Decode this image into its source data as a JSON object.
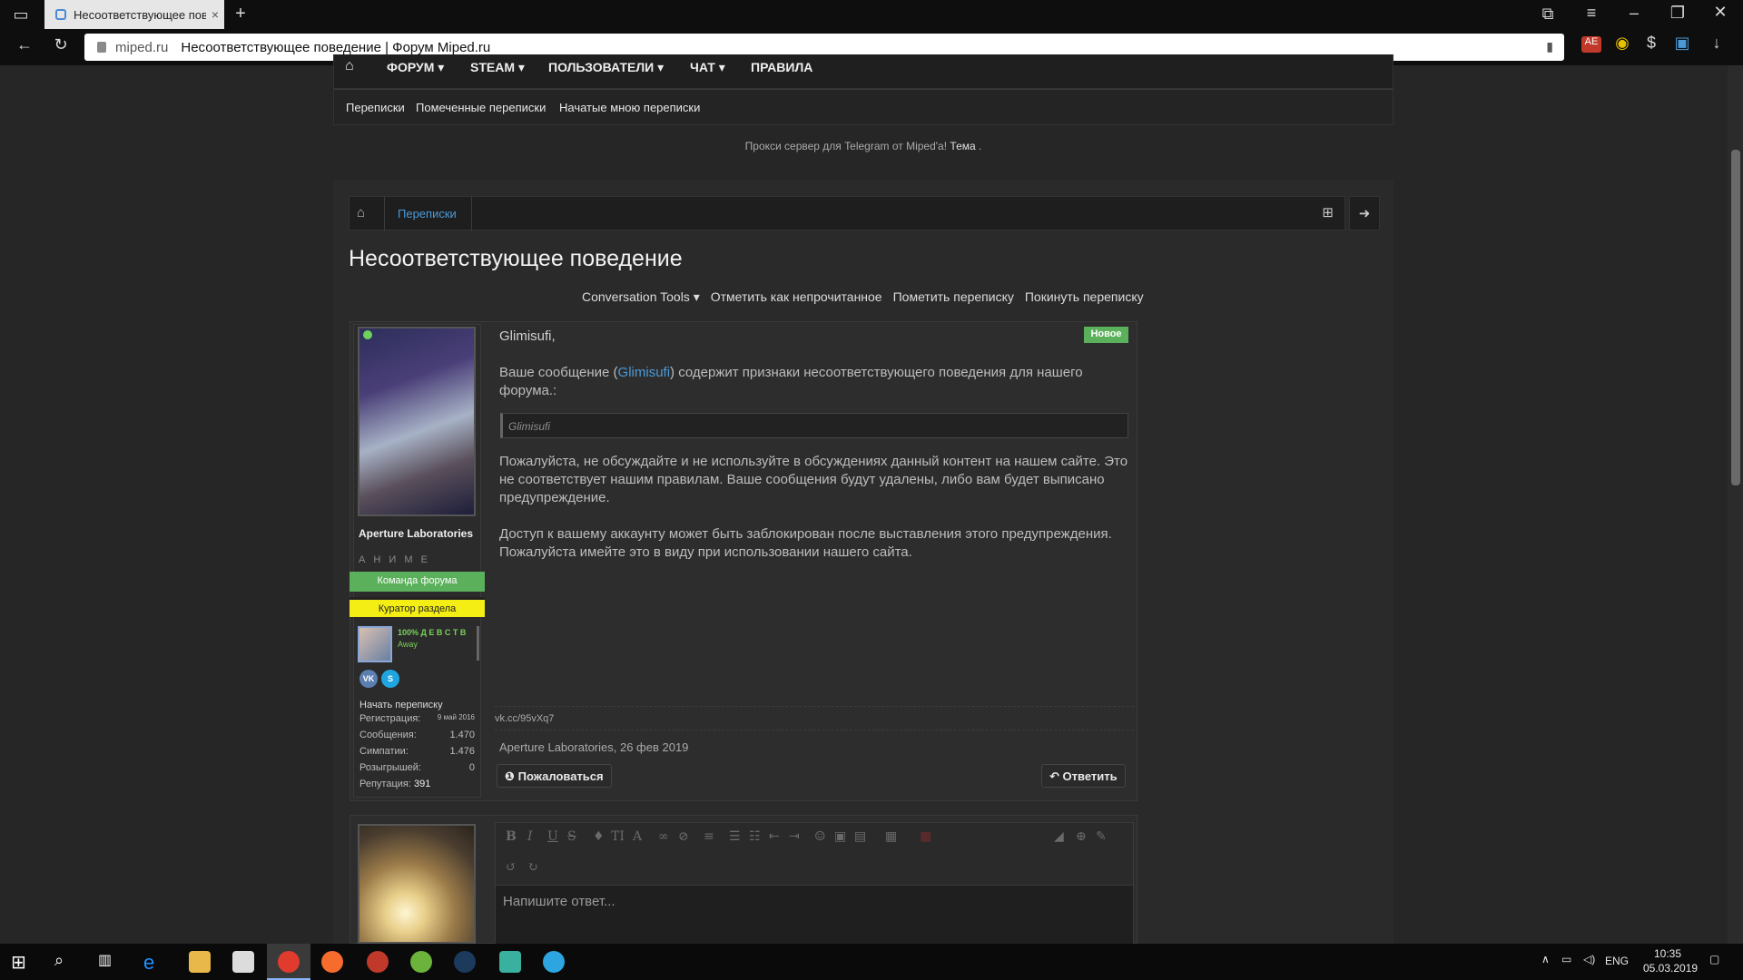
{
  "browser": {
    "tab_title": "Несоответствующее пове",
    "tab_close": "×",
    "new_tab": "+",
    "url_host": "miped.ru",
    "url_title": "Несоответствующее поведение | Форум Miped.ru",
    "back": "←",
    "reload": "↻",
    "bookmark": "▮",
    "download": "↓"
  },
  "nav": {
    "home": "⌂",
    "items": [
      "ФОРУМ ▾",
      "STEAM ▾",
      "ПОЛЬЗОВАТЕЛИ ▾",
      "ЧАТ ▾",
      "ПРАВИЛА"
    ]
  },
  "subnav": {
    "items": [
      "Переписки",
      "Помеченные переписки",
      "Начатые мною переписки"
    ]
  },
  "notice": {
    "text": "Прокси сервер для Telegram от Miped'a!",
    "link": "Тема",
    "suffix": "."
  },
  "breadcrumbs": {
    "crumb": "Переписки"
  },
  "page": {
    "title": "Несоответствующее поведение",
    "tools": [
      "Conversation Tools ▾",
      "Отметить как непрочитанное",
      "Пометить переписку",
      "Покинуть переписку"
    ]
  },
  "author": {
    "name": "Aperture Laboratories",
    "title": "А Н И М Е",
    "badge_team": "Команда форума",
    "badge_curator": "Куратор раздела",
    "mini_name": "100% Д Е В С Т В",
    "mini_status": "Away",
    "social_vk": "VK",
    "social_skype": "S",
    "start_conversation": "Начать переписку",
    "stats": [
      {
        "label": "Регистрация:",
        "value": "9 май 2016"
      },
      {
        "label": "Сообщения:",
        "value": "1.470"
      },
      {
        "label": "Симпатии:",
        "value": "1.476"
      },
      {
        "label": "Розыгрышей:",
        "value": "0"
      },
      {
        "label": "Репутация:",
        "value": "391"
      }
    ]
  },
  "message": {
    "greeting": "Glimisufi,",
    "new_badge": "Новое",
    "p1_before": "Ваше сообщение (",
    "p1_link": "Glimisufi",
    "p1_after": ") содержит признаки несоответствующего поведения для нашего форума.:",
    "quote": "Glimisufi",
    "p2": "Пожалуйста, не обсуждайте и не используйте в обсуждениях данный контент на нашем сайте. Это не соответствует нашим правилам. Ваше сообщения будут удалены, либо вам будет выписано предупреждение.",
    "p3": "Доступ к вашему аккаунту может быть заблокирован после выставления этого предупреждения. Пожалуйста имейте это в виду при использовании нашего сайта.",
    "signature": "vk.cc/95vXq7",
    "meta": "Aperture Laboratories, 26 фев 2019",
    "report": "Пожаловаться",
    "reply": "Ответить"
  },
  "editor": {
    "placeholder": "Напишите ответ..."
  },
  "taskbar": {
    "lang": "ENG",
    "time": "10:35",
    "date": "05.03.2019"
  }
}
